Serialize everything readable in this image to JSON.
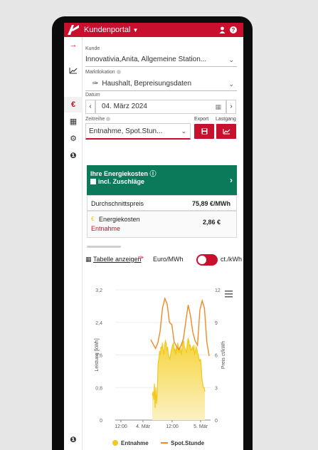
{
  "header": {
    "portal": "Kundenportal",
    "user_icon": "user-icon",
    "help_icon": "help-icon"
  },
  "rail": {
    "items": [
      {
        "name": "arrow-right-icon",
        "glyph": "→"
      },
      {
        "name": "line-chart-icon",
        "glyph": "⟋"
      },
      {
        "name": "euro-icon",
        "glyph": "€"
      },
      {
        "name": "calendar-icon",
        "glyph": "▦"
      },
      {
        "name": "settings-icon",
        "glyph": "⚙"
      },
      {
        "name": "info-icon",
        "glyph": "❶"
      }
    ],
    "bottom_icon": "info-icon"
  },
  "form": {
    "kunde_label": "Kunde",
    "kunde_value": "Innovativia,Anita, Allgemeine Station...",
    "markt_label": "Marktlokation",
    "markt_value": "Haushalt, Bepreisungsdaten",
    "datum_label": "Datum",
    "datum_value": "04. März 2024",
    "zeit_label": "Zeitreihe",
    "zeit_value": "Entnahme,  Spot.Stun...",
    "export_label": "Export",
    "lastgang_label": "Lastgang"
  },
  "cost": {
    "title": "Ihre Energiekosten",
    "subtitle": "incl. Zuschläge",
    "avg_label": "Durchschnittspreis",
    "avg_value": "75,89 €/MWh",
    "cost_label": "Energiekosten",
    "cost_value": "2,86 €",
    "cost_sub": "Entnahme"
  },
  "controls": {
    "table_link": "Tabelle anzeigen",
    "unit_left": "Euro/MWh",
    "unit_right": "ct./kWh"
  },
  "chart_data": {
    "type": "line",
    "x_ticks": [
      "12:00",
      "4. Mär",
      "12:00",
      "5. Mär"
    ],
    "x_tick_pos": [
      0.32,
      0.5,
      0.75,
      1.0
    ],
    "y_left": {
      "label": "Leistung [kWh]",
      "ticks": [
        "0",
        "0,8",
        "1,6",
        "2,4",
        "3,2"
      ],
      "range": [
        0,
        3.2
      ]
    },
    "y_right": {
      "label": "Preis ct/kWh",
      "ticks": [
        "0",
        "3",
        "6",
        "9",
        "12"
      ],
      "range": [
        0,
        12
      ]
    },
    "series": [
      {
        "name": "Entnahme",
        "type": "area",
        "axis": "left",
        "color": "#f2c81e",
        "x": [
          0.27,
          0.28,
          0.29,
          0.3,
          0.31,
          0.32,
          0.33,
          0.34,
          0.35,
          0.36,
          0.37,
          0.38,
          0.39,
          0.4,
          0.41,
          0.42,
          0.43,
          0.44,
          0.45,
          0.46,
          0.47,
          0.48,
          0.49,
          0.5,
          0.51,
          0.52,
          0.53,
          0.54,
          0.55,
          0.56,
          0.57,
          0.58,
          0.59,
          0.6,
          0.61,
          0.62,
          0.63,
          0.64,
          0.65,
          0.66,
          0.67,
          0.68,
          0.69,
          0.7,
          0.71,
          0.72,
          0.73,
          0.74,
          0.75,
          0.76,
          0.77,
          0.78,
          0.79,
          0.8,
          0.81,
          0.82,
          0.83,
          0.84,
          0.85,
          0.86,
          0.87,
          0.88,
          0.89,
          0.9,
          0.91,
          0.92,
          0.93,
          0.94,
          0.95,
          0.96,
          0.97,
          0.98,
          0.99
        ],
        "values": [
          0.6,
          0.7,
          0.5,
          0.9,
          0.3,
          0.8,
          0.4,
          0.7,
          1.4,
          1.5,
          1.7,
          1.6,
          1.8,
          1.75,
          1.9,
          1.7,
          1.6,
          1.85,
          1.95,
          1.9,
          1.7,
          1.8,
          1.6,
          1.55,
          1.5,
          1.6,
          1.7,
          1.8,
          1.85,
          1.9,
          1.7,
          1.75,
          1.6,
          1.8,
          1.7,
          1.9,
          1.75,
          1.65,
          1.8,
          1.7,
          1.6,
          1.85,
          1.9,
          1.95,
          1.8,
          1.75,
          1.7,
          1.65,
          1.9,
          2.0,
          1.95,
          1.8,
          1.85,
          1.7,
          1.75,
          1.8,
          1.7,
          1.85,
          1.6,
          1.7,
          1.8,
          1.75,
          1.65,
          1.6,
          1.5,
          1.45,
          1.5,
          1.3,
          1.0,
          0.9,
          0.8,
          0.8,
          0.7
        ]
      },
      {
        "name": "Spot.Stunde",
        "type": "line",
        "axis": "right",
        "color": "#f08a24",
        "x": [
          0.0,
          0.04,
          0.08,
          0.12,
          0.16,
          0.2,
          0.24,
          0.28,
          0.32,
          0.36,
          0.4,
          0.44,
          0.48,
          0.52,
          0.56,
          0.6,
          0.64,
          0.68,
          0.72,
          0.76,
          0.8,
          0.84,
          0.88,
          0.92,
          0.96,
          1.0
        ],
        "values": [
          7.4,
          7.0,
          6.6,
          7.1,
          8.2,
          10.3,
          11.2,
          10.7,
          9.0,
          8.8,
          7.2,
          6.8,
          6.5,
          6.9,
          7.5,
          9.1,
          10.6,
          9.6,
          8.1,
          7.3,
          6.9,
          10.1,
          11.0,
          10.3,
          7.2,
          5.9
        ]
      }
    ],
    "legend": [
      "Entnahme",
      "Spot.Stunde"
    ],
    "legend_position": "bottom"
  }
}
